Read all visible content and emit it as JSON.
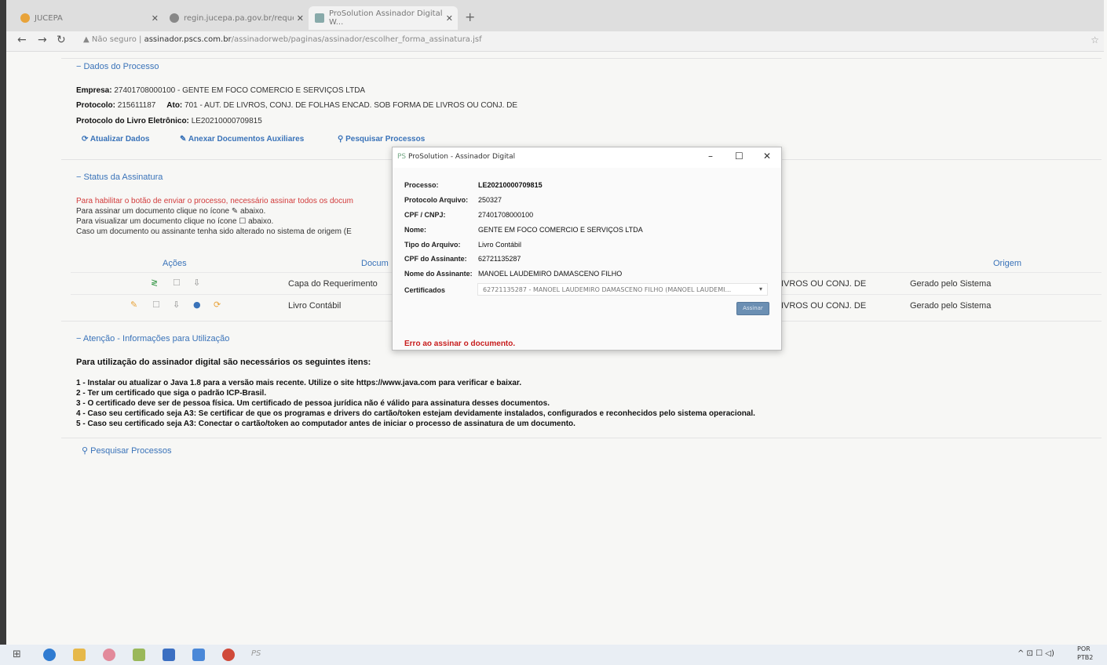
{
  "browser": {
    "tabs": [
      {
        "label": "JUCEPA"
      },
      {
        "label": "regin.jucepa.pa.gov.br/requerim..."
      },
      {
        "label": "ProSolution Assinador Digital W..."
      }
    ],
    "url_prefix": "Não seguro",
    "url_host": "assinador.pscs.com.br",
    "url_path": "/assinadorweb/paginas/assinador/escolher_forma_assinatura.jsf"
  },
  "dados": {
    "title": "− Dados do Processo",
    "empresa_label": "Empresa:",
    "empresa_value": "27401708000100 - GENTE EM FOCO COMERCIO E SERVIÇOS LTDA",
    "protocolo_label": "Protocolo:",
    "protocolo_value": "215611187",
    "ato_label": "Ato:",
    "ato_value": "701 - AUT. DE LIVROS, CONJ. DE FOLHAS ENCAD. SOB FORMA DE LIVROS OU CONJ. DE",
    "livro_label": "Protocolo do Livro Eletrônico:",
    "livro_value": "LE20210000709815",
    "btn_atualizar": "Atualizar Dados",
    "btn_anexar": "Anexar Documentos Auxiliares",
    "btn_pesquisar": "Pesquisar Processos"
  },
  "status": {
    "title": "− Status da Assinatura",
    "line1": "Para habilitar o botão de enviar o processo, necessário assinar todos os docum",
    "line2": "Para assinar um documento clique no ícone ✎ abaixo.",
    "line3": "Para visualizar um documento clique no ícone ☐ abaixo.",
    "line4": "Caso um documento ou assinante tenha sido alterado no sistema de origem (E"
  },
  "table": {
    "headers": {
      "acoes": "Ações",
      "documento": "Docum",
      "origem": "Origem"
    },
    "rows": [
      {
        "documento": "Capa do Requerimento",
        "ato": "IVROS OU CONJ. DE",
        "origem": "Gerado pelo Sistema"
      },
      {
        "documento": "Livro Contábil",
        "ato": "IVROS OU CONJ. DE",
        "origem": "Gerado pelo Sistema"
      }
    ]
  },
  "atencao": {
    "title": "− Atenção - Informações para Utilização",
    "intro": "Para utilização do assinador digital são necessários os seguintes itens:",
    "items": [
      "1 - Instalar ou atualizar o Java 1.8 para a versão mais recente. Utilize o site https://www.java.com para verificar e baixar.",
      "2 - Ter um certificado que siga o padrão ICP-Brasil.",
      "3 - O certificado deve ser de pessoa física. Um certificado de pessoa jurídica não é válido para assinatura desses documentos.",
      "4 - Caso seu certificado seja A3: Se certificar de que os programas e drivers do cartão/token estejam devidamente instalados, configurados e reconhecidos pelo sistema operacional.",
      "5 - Caso seu certificado seja A3: Conectar o cartão/token ao computador antes de iniciar o processo de assinatura de um documento."
    ],
    "btn_pesquisar": "Pesquisar Processos"
  },
  "dialog": {
    "title": "ProSolution - Assinador Digital",
    "fields": [
      {
        "label": "Processo:",
        "value": "LE20210000709815"
      },
      {
        "label": "Protocolo Arquivo:",
        "value": "250327"
      },
      {
        "label": "CPF / CNPJ:",
        "value": "27401708000100"
      },
      {
        "label": "Nome:",
        "value": "GENTE EM FOCO COMERCIO E SERVIÇOS LTDA"
      },
      {
        "label": "Tipo do Arquivo:",
        "value": "Livro Contábil"
      },
      {
        "label": "CPF do Assinante:",
        "value": "62721135287"
      },
      {
        "label": "Nome do Assinante:",
        "value": "MANOEL LAUDEMIRO DAMASCENO FILHO"
      }
    ],
    "cert_label": "Certificados",
    "cert_value": "62721135287 - MANOEL LAUDEMIRO DAMASCENO FILHO (MANOEL LAUDEMI...",
    "sign_button": "Assinar",
    "error": "Erro ao assinar o documento."
  },
  "taskbar": {
    "lang_top": "POR",
    "lang_bottom": "PTB2"
  },
  "colors": {
    "accent": "#3a73b9",
    "error": "#c81e1e"
  }
}
